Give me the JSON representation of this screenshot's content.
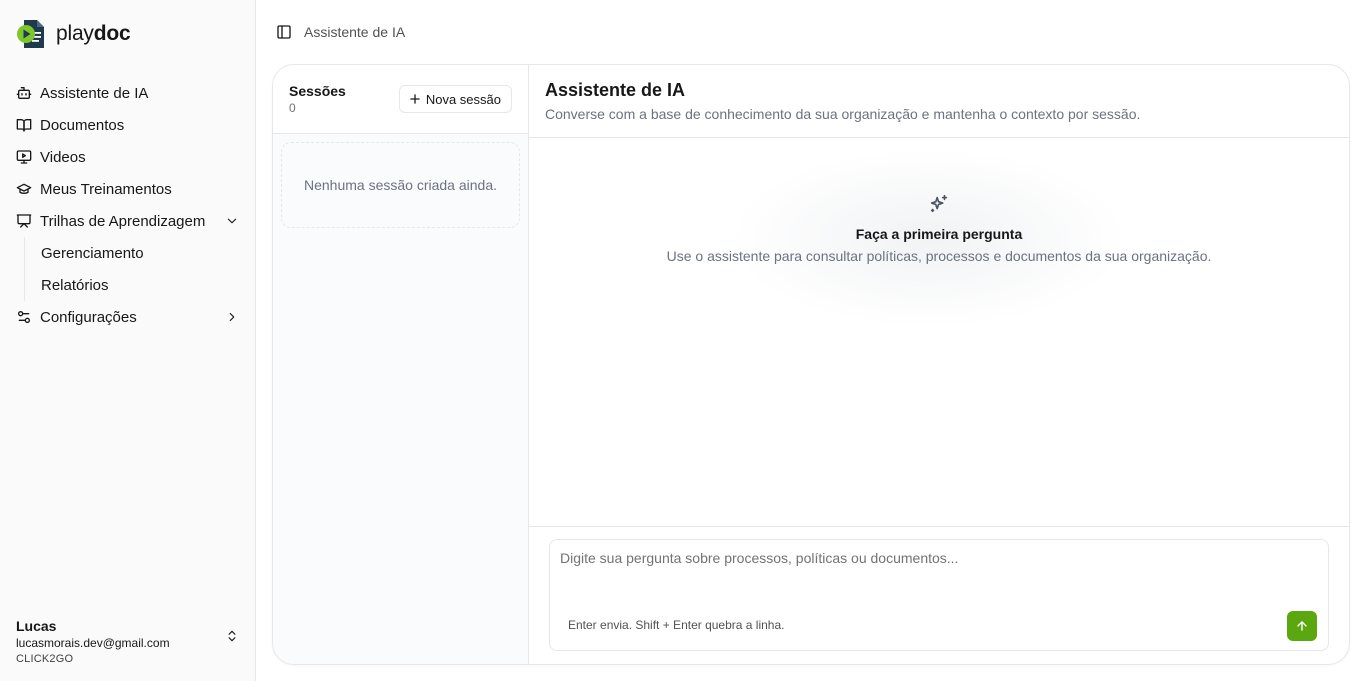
{
  "brand": {
    "name_light": "play",
    "name_bold": "doc"
  },
  "sidebar": {
    "items": [
      {
        "label": "Assistente de IA",
        "icon": "bot-icon"
      },
      {
        "label": "Documentos",
        "icon": "book-open-icon"
      },
      {
        "label": "Videos",
        "icon": "monitor-play-icon"
      },
      {
        "label": "Meus Treinamentos",
        "icon": "graduation-cap-icon"
      },
      {
        "label": "Trilhas de Aprendizagem",
        "icon": "presentation-icon",
        "expanded": true,
        "children": [
          {
            "label": "Gerenciamento"
          },
          {
            "label": "Relatórios"
          }
        ]
      },
      {
        "label": "Configurações",
        "icon": "settings-sliders-icon",
        "expanded": false
      }
    ]
  },
  "user": {
    "name": "Lucas",
    "email": "lucasmorais.dev@gmail.com",
    "org": "CLICK2GO"
  },
  "topbar": {
    "breadcrumb": "Assistente de IA"
  },
  "sessions": {
    "title": "Sessões",
    "count": "0",
    "new_label": "Nova sessão",
    "empty": "Nenhuma sessão criada ainda."
  },
  "chat": {
    "title": "Assistente de IA",
    "subtitle": "Converse com a base de conhecimento da sua organização e mantenha o contexto por sessão.",
    "empty_title": "Faça a primeira pergunta",
    "empty_sub": "Use o assistente para consultar políticas, processos e documentos da sua organização.",
    "input_placeholder": "Digite sua pergunta sobre processos, políticas ou documentos...",
    "hint": "Enter envia. Shift + Enter quebra a linha."
  },
  "colors": {
    "accent": "#5aa70f",
    "logo_dark": "#1f3a4d",
    "logo_green": "#7dc62b"
  }
}
